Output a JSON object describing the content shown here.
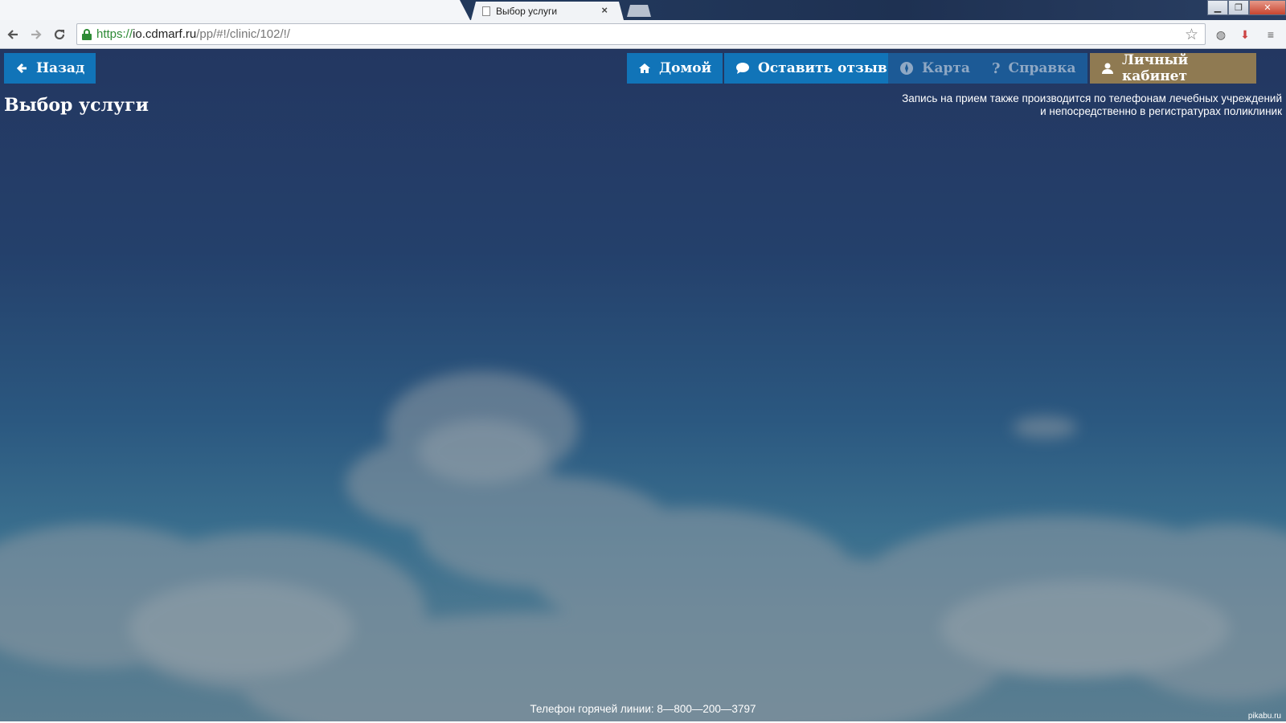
{
  "browser": {
    "active_tab_title": "Выбор услуги",
    "url": {
      "scheme": "https://",
      "host": "io.cdmarf.ru",
      "path": "/pp/#!/clinic/102/!/"
    }
  },
  "nav": {
    "back": {
      "label": "Назад",
      "icon": "arrow-left-icon"
    },
    "home": {
      "label": "Домой",
      "icon": "home-icon"
    },
    "feedback": {
      "label": "Оставить отзыв",
      "icon": "comment-icon"
    },
    "map": {
      "label": "Карта",
      "icon": "compass-icon"
    },
    "help": {
      "label": "Справка",
      "icon": "question-icon"
    },
    "cabinet": {
      "label": "Личный кабинет",
      "icon": "user-icon"
    }
  },
  "colors": {
    "button_blue": "#1174b8",
    "button_dim": "#1c5a96",
    "button_cabinet": "#8f7a52"
  },
  "page": {
    "title": "Выбор услуги",
    "notice_line1": "Запись на прием также производится по телефонам лечебных учреждений",
    "notice_line2": "и непосредственно в регистратурах поликлиник",
    "footer": "Телефон горячей линии: 8—800—200—3797",
    "watermark": "pikabu.ru"
  }
}
